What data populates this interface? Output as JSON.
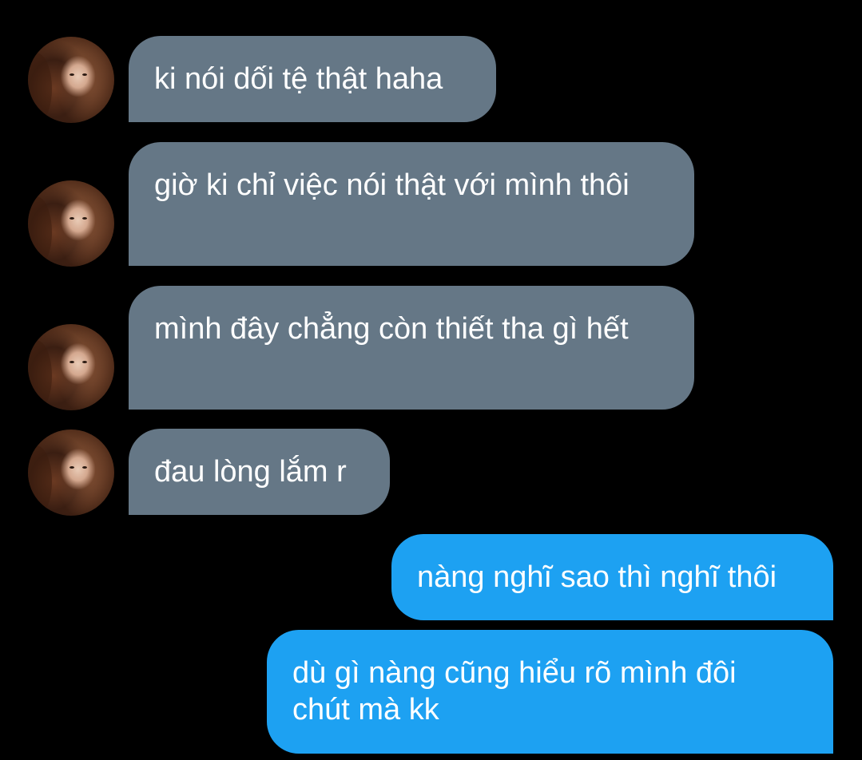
{
  "conversation": {
    "messages": [
      {
        "direction": "incoming",
        "avatar_icon": "profile-photo",
        "text": "ki nói dối tệ thật haha"
      },
      {
        "direction": "incoming",
        "avatar_icon": "profile-photo",
        "text": "giờ ki chỉ việc nói thật với mình thôi"
      },
      {
        "direction": "incoming",
        "avatar_icon": "profile-photo",
        "text": "mình đây chẳng còn thiết tha gì hết"
      },
      {
        "direction": "incoming",
        "avatar_icon": "profile-photo",
        "text": "đau lòng lắm r"
      },
      {
        "direction": "outgoing",
        "text": "nàng nghĩ sao thì nghĩ thôi"
      },
      {
        "direction": "outgoing",
        "text": "dù gì nàng cũng hiểu rõ mình đôi chút mà kk"
      }
    ]
  },
  "colors": {
    "background": "#000000",
    "incoming_bubble": "#657786",
    "outgoing_bubble": "#1da1f2",
    "text": "#ffffff"
  }
}
